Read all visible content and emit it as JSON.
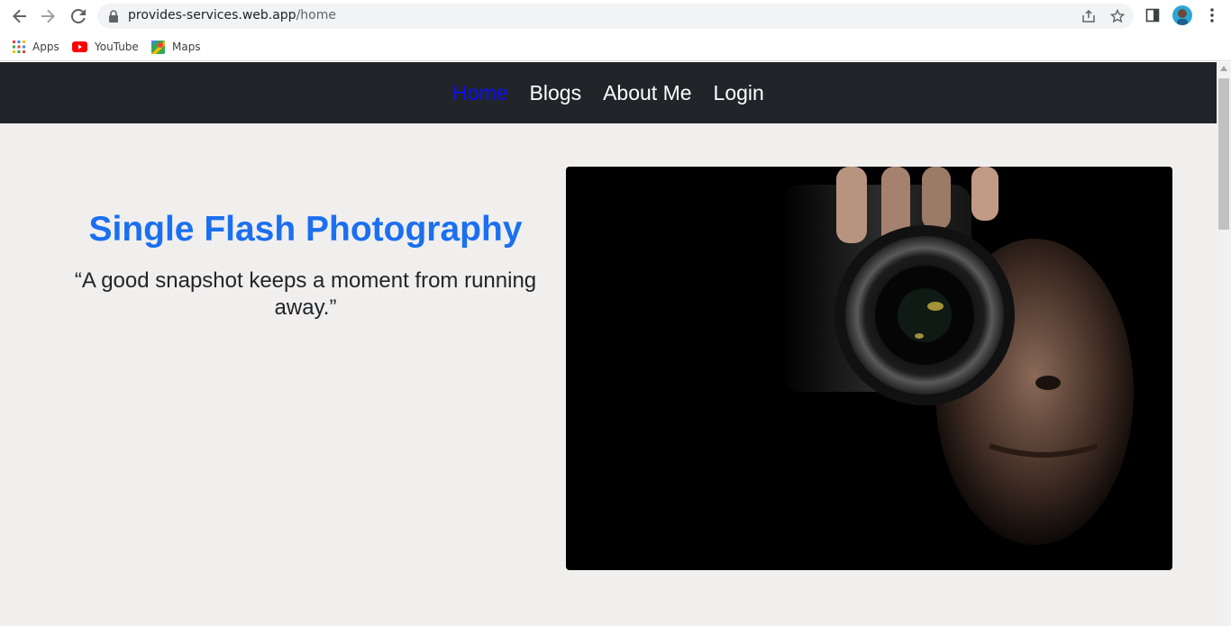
{
  "browser": {
    "url_domain": "provides-services.web.app",
    "url_path": "/home",
    "bookmarks": [
      {
        "label": "Apps"
      },
      {
        "label": "YouTube"
      },
      {
        "label": "Maps"
      }
    ]
  },
  "site": {
    "nav": {
      "items": [
        {
          "label": "Home",
          "active": true
        },
        {
          "label": "Blogs",
          "active": false
        },
        {
          "label": "About Me",
          "active": false
        },
        {
          "label": "Login",
          "active": false
        }
      ]
    },
    "hero": {
      "title": "Single Flash Photography",
      "quote": "“A good snapshot keeps a moment from running away.”",
      "image_icon": "photographer-with-camera-image"
    }
  },
  "colors": {
    "nav_bg": "#212529",
    "nav_active": "#0d0dff",
    "title": "#1b6ff0",
    "page_bg": "#f0efee"
  }
}
